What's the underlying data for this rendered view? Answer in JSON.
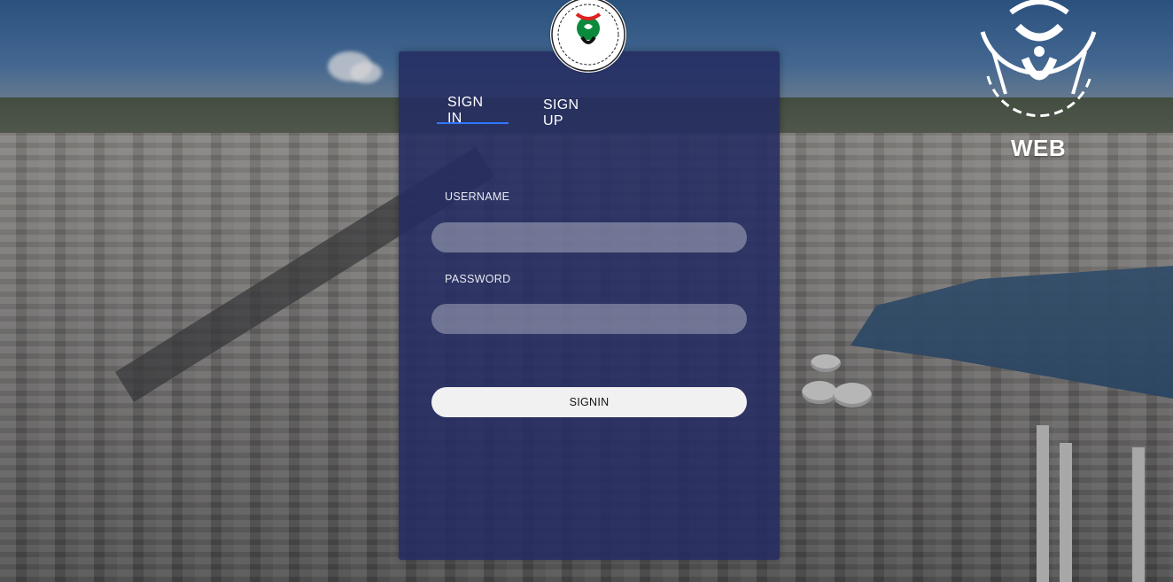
{
  "auth_tabs": {
    "signin_label": "SIGN IN",
    "signup_label": "SIGN UP",
    "active": "signin"
  },
  "form": {
    "username_label": "USERNAME",
    "username_value": "",
    "password_label": "PASSWORD",
    "password_value": "",
    "submit_label": "SIGNIN"
  },
  "branding": {
    "corner_logo_text": "WEB"
  },
  "colors": {
    "panel_bg": "#242c62",
    "tab_underline": "#2e78ff",
    "button_bg": "#f1f1f1"
  },
  "icons": {
    "top_emblem": "channel-emblem-icon",
    "corner_logo": "channel-logo-icon"
  }
}
